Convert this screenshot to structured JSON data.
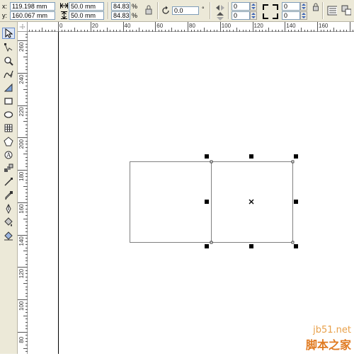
{
  "property_bar": {
    "x_label": "x:",
    "x_value": "119.198 mm",
    "y_label": "y:",
    "y_value": "160.067 mm",
    "width_value": "50.0 mm",
    "height_value": "50.0 mm",
    "scale_x": "84.83",
    "scale_y": "84.83",
    "scale_unit_x": "%",
    "scale_unit_y": "%",
    "rotation_value": "0.0",
    "rotation_unit": "°",
    "mirror_fields": [
      "0",
      "0"
    ],
    "corner_fields": [
      "0",
      "0"
    ]
  },
  "ruler_h": {
    "labels": [
      "0",
      "20",
      "40",
      "60",
      "80",
      "100",
      "120",
      "140",
      "160"
    ]
  },
  "ruler_v": {
    "labels": [
      "260",
      "240",
      "220",
      "200",
      "180",
      "160",
      "140",
      "120",
      "100",
      "80"
    ]
  },
  "toolbox": {
    "tools": [
      "pick-tool",
      "shape-tool",
      "zoom-tool",
      "freehand-tool",
      "smart-fill-tool",
      "rectangle-tool",
      "ellipse-tool",
      "polygon-tool",
      "basic-shapes-tool",
      "text-tool",
      "interactive-blend-tool",
      "transparency-tool",
      "eyedropper-tool",
      "outline-tool",
      "fill-tool",
      "interactive-fill-tool"
    ]
  },
  "watermark": {
    "line1": "jb51.net",
    "line2": "脚本之家"
  },
  "colors": {
    "ui_background": "#ece9d8",
    "field_border": "#7f9db9",
    "handle": "#000000"
  }
}
